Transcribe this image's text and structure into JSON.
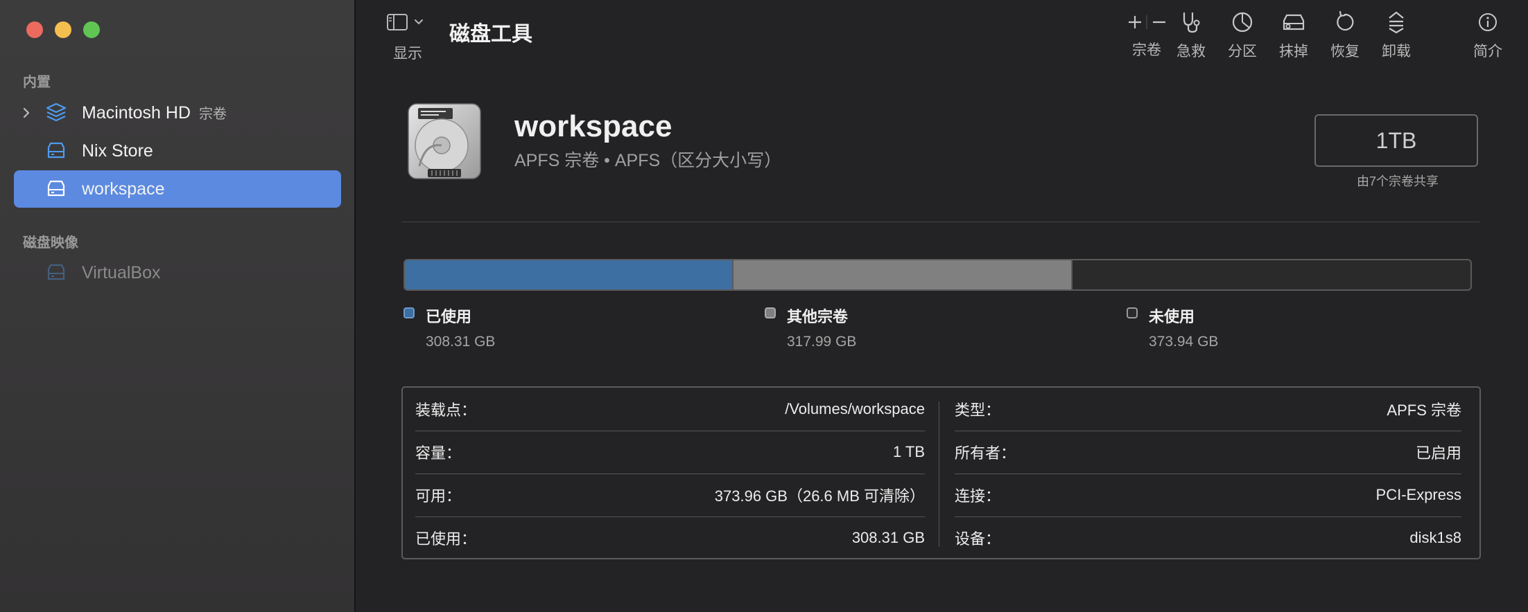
{
  "sidebar": {
    "section_internal": "内置",
    "section_images": "磁盘映像",
    "items": [
      {
        "label": "Macintosh HD",
        "sub": "宗卷"
      },
      {
        "label": "Nix Store"
      },
      {
        "label": "workspace"
      },
      {
        "label": "VirtualBox"
      }
    ]
  },
  "toolbar": {
    "view_label": "显示",
    "title": "磁盘工具",
    "volume_label": "宗卷",
    "first_aid_label": "急救",
    "partition_label": "分区",
    "erase_label": "抹掉",
    "restore_label": "恢复",
    "unmount_label": "卸载",
    "info_label": "简介"
  },
  "volume": {
    "name": "workspace",
    "description": "APFS 宗卷 • APFS（区分大小写）",
    "size": "1TB",
    "shared_caption": "由7个宗卷共享"
  },
  "usage": {
    "used_fraction": 0.3083,
    "other_fraction": 0.318,
    "colors": {
      "used": "#3e6fa3",
      "other": "#808080",
      "free": "#2a2a2b"
    },
    "legend": [
      {
        "name": "已使用",
        "value": "308.31 GB"
      },
      {
        "name": "其他宗卷",
        "value": "317.99 GB"
      },
      {
        "name": "未使用",
        "value": "373.94 GB"
      }
    ]
  },
  "info": {
    "left": [
      {
        "label": "装载点：",
        "value": "/Volumes/workspace"
      },
      {
        "label": "容量：",
        "value": "1 TB"
      },
      {
        "label": "可用：",
        "value": "373.96 GB（26.6 MB 可清除）"
      },
      {
        "label": "已使用：",
        "value": "308.31 GB"
      }
    ],
    "right": [
      {
        "label": "类型：",
        "value": "APFS 宗卷"
      },
      {
        "label": "所有者：",
        "value": "已启用"
      },
      {
        "label": "连接：",
        "value": "PCI-Express"
      },
      {
        "label": "设备：",
        "value": "disk1s8"
      }
    ]
  }
}
